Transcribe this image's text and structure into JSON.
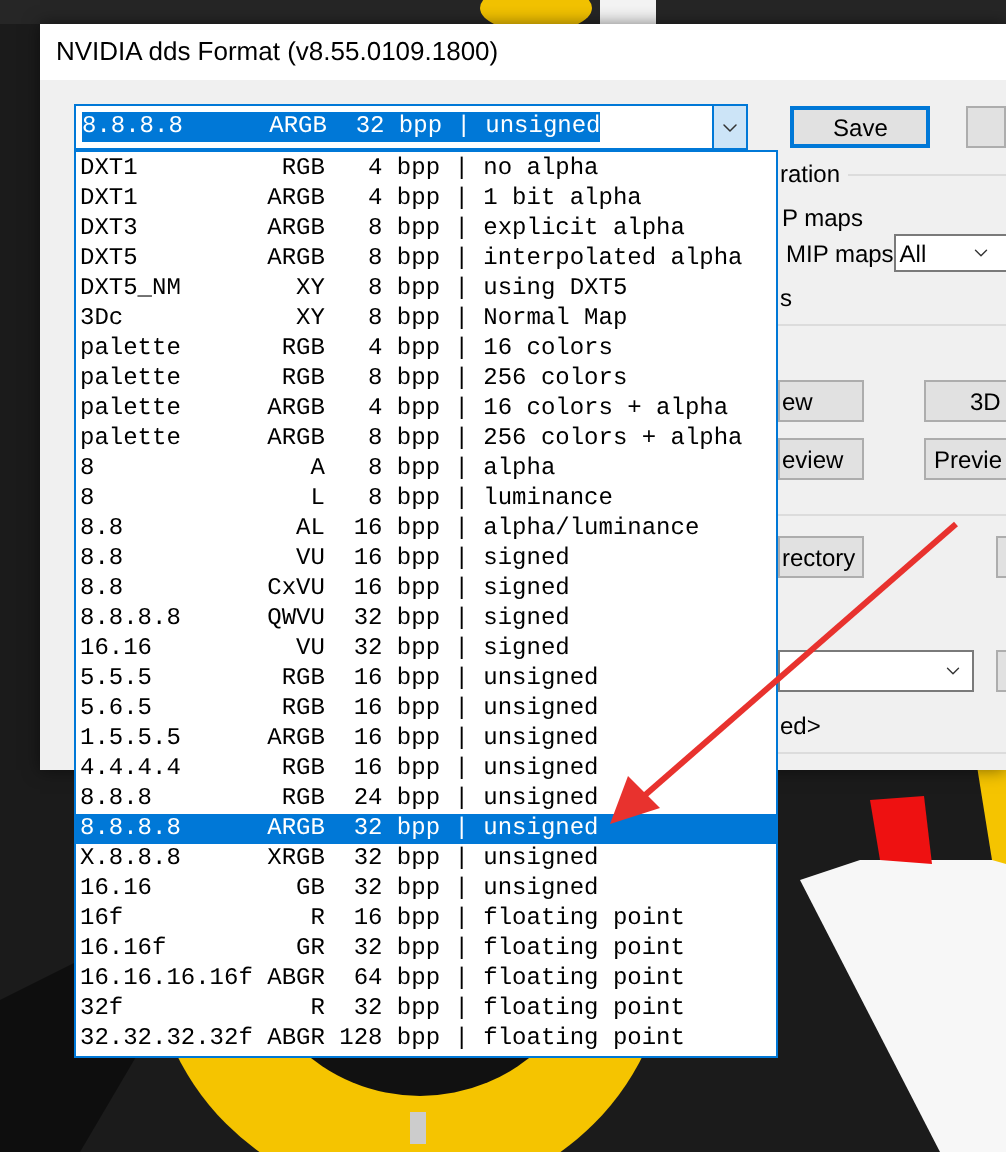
{
  "window": {
    "title": "NVIDIA dds Format (v8.55.0109.1800)"
  },
  "format_combo": {
    "value": "8.8.8.8      ARGB  32 bpp | unsigned",
    "expanded": true
  },
  "format_list": [
    {
      "text": "DXT1          RGB   4 bpp | no alpha",
      "selected": false
    },
    {
      "text": "DXT1         ARGB   4 bpp | 1 bit alpha",
      "selected": false
    },
    {
      "text": "DXT3         ARGB   8 bpp | explicit alpha",
      "selected": false
    },
    {
      "text": "DXT5         ARGB   8 bpp | interpolated alpha",
      "selected": false
    },
    {
      "text": "DXT5_NM        XY   8 bpp | using DXT5",
      "selected": false
    },
    {
      "text": "3Dc            XY   8 bpp | Normal Map",
      "selected": false
    },
    {
      "text": "palette       RGB   4 bpp | 16 colors",
      "selected": false
    },
    {
      "text": "palette       RGB   8 bpp | 256 colors",
      "selected": false
    },
    {
      "text": "palette      ARGB   4 bpp | 16 colors + alpha",
      "selected": false
    },
    {
      "text": "palette      ARGB   8 bpp | 256 colors + alpha",
      "selected": false
    },
    {
      "text": "8               A   8 bpp | alpha",
      "selected": false
    },
    {
      "text": "8               L   8 bpp | luminance",
      "selected": false
    },
    {
      "text": "8.8            AL  16 bpp | alpha/luminance",
      "selected": false
    },
    {
      "text": "8.8            VU  16 bpp | signed",
      "selected": false
    },
    {
      "text": "8.8          CxVU  16 bpp | signed",
      "selected": false
    },
    {
      "text": "8.8.8.8      QWVU  32 bpp | signed",
      "selected": false
    },
    {
      "text": "16.16          VU  32 bpp | signed",
      "selected": false
    },
    {
      "text": "5.5.5         RGB  16 bpp | unsigned",
      "selected": false
    },
    {
      "text": "5.6.5         RGB  16 bpp | unsigned",
      "selected": false
    },
    {
      "text": "1.5.5.5      ARGB  16 bpp | unsigned",
      "selected": false
    },
    {
      "text": "4.4.4.4       RGB  16 bpp | unsigned",
      "selected": false
    },
    {
      "text": "8.8.8         RGB  24 bpp | unsigned",
      "selected": false
    },
    {
      "text": "8.8.8.8      ARGB  32 bpp | unsigned",
      "selected": true
    },
    {
      "text": "X.8.8.8      XRGB  32 bpp | unsigned",
      "selected": false
    },
    {
      "text": "16.16          GB  32 bpp | unsigned",
      "selected": false
    },
    {
      "text": "16f             R  16 bpp | floating point",
      "selected": false
    },
    {
      "text": "16.16f         GR  32 bpp | floating point",
      "selected": false
    },
    {
      "text": "16.16.16.16f ABGR  64 bpp | floating point",
      "selected": false
    },
    {
      "text": "32f             R  32 bpp | floating point",
      "selected": false
    },
    {
      "text": "32.32.32.32f ABGR 128 bpp | floating point",
      "selected": false
    }
  ],
  "save_button": "Save",
  "right_panel": {
    "group_label": "ration",
    "mip_label": "P maps",
    "generate_label": "MIP maps",
    "mip_select": "All",
    "option_label": "s",
    "buttons": [
      "ew",
      "3D",
      "eview",
      "Previe"
    ],
    "directory_button": "rectory",
    "path_note": "ed>"
  }
}
